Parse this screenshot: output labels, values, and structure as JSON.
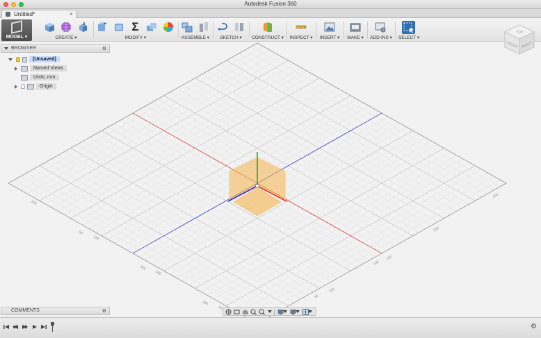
{
  "app": {
    "window_title": "Autodesk Fusion 360",
    "tab_title": "Untitled*",
    "tab_close": "×"
  },
  "toolbar": {
    "workspace_label": "MODEL ▾",
    "groups": [
      {
        "label": "CREATE ▾"
      },
      {
        "label": "MODIFY ▾"
      },
      {
        "label": "ASSEMBLE ▾"
      },
      {
        "label": "SKETCH ▾"
      },
      {
        "label": "CONSTRUCT ▾"
      },
      {
        "label": "INSPECT ▾"
      },
      {
        "label": "INSERT ▾"
      },
      {
        "label": "MAKE ▾"
      },
      {
        "label": "ADD-INS ▾"
      },
      {
        "label": "SELECT ▾"
      }
    ],
    "sigma_glyph": "Σ"
  },
  "browser": {
    "title": "BROWSER",
    "gear": "⚙",
    "root": "(Unsaved)",
    "nodes": [
      "Named Views",
      "Units: mm",
      "Origin"
    ]
  },
  "comments": {
    "title": "COMMENTS",
    "gear": "⚙"
  },
  "viewcube": {
    "top": "TOP",
    "front": "FRONT",
    "right": "RIGHT"
  },
  "grid_labels": {
    "left": [
      "200",
      "150",
      "100",
      "50"
    ],
    "bottom_left": [
      "50",
      "100",
      "150"
    ],
    "bottom_right": [
      "50",
      "100",
      "150"
    ],
    "right": [
      "50",
      "100",
      "150",
      "200"
    ]
  },
  "colors": {
    "x_axis": "#e03030",
    "y_axis": "#2ea82e",
    "z_axis": "#2a2ad0",
    "origin_plane": "#f5b650",
    "select_accent": "#2f6fb0",
    "selected_node": "#c7dcf6"
  },
  "timeline": {
    "settings": "⚙"
  }
}
